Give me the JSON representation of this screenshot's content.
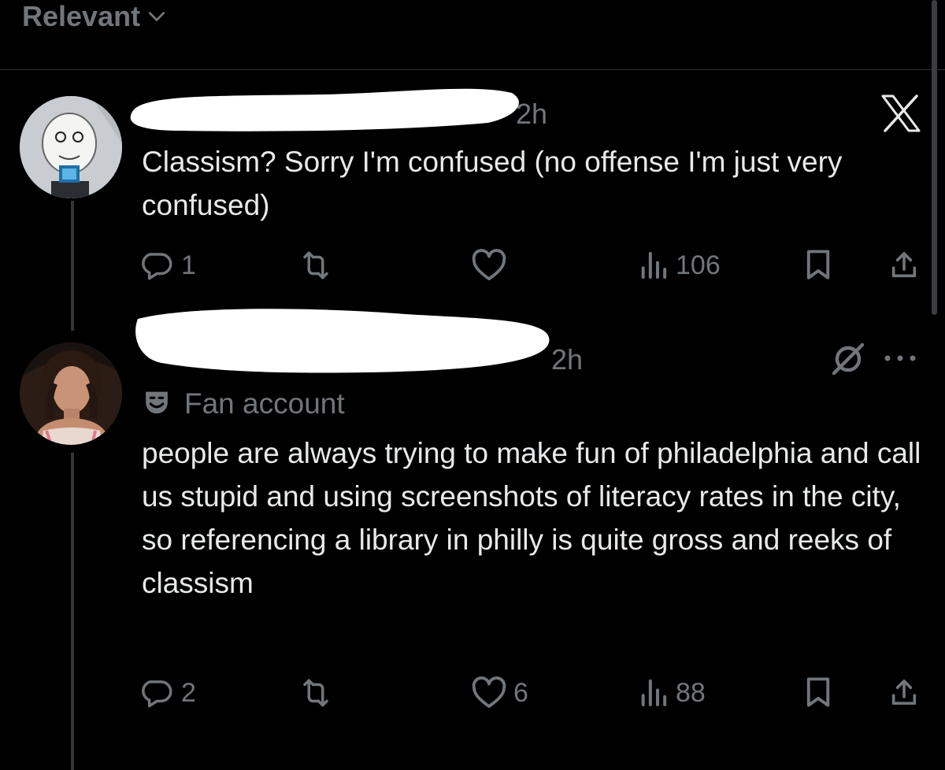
{
  "header": {
    "sort_label": "Relevant"
  },
  "replies": [
    {
      "time": "2h",
      "text": "Classism? Sorry I'm confused (no offense I'm just very confused)",
      "stats": {
        "replies": "1",
        "reposts": "",
        "likes": "",
        "views": "106"
      }
    },
    {
      "time": "2h",
      "badge": "Fan account",
      "text": "people are always trying to make fun of philadelphia and call us stupid and using screenshots of literacy rates in the city, so referencing a library in philly is quite gross and reeks of classism",
      "stats": {
        "replies": "2",
        "reposts": "",
        "likes": "6",
        "views": "88"
      }
    }
  ],
  "colors": {
    "background": "#000000",
    "text": "#e7e9ea",
    "muted": "#71767b",
    "divider": "#2f3336",
    "thread_line": "#333639"
  },
  "icons": [
    "chevron-down-icon",
    "x-logo-icon",
    "grok-icon",
    "more-icon",
    "theater-masks-icon",
    "reply-icon",
    "repost-icon",
    "like-icon",
    "views-icon",
    "bookmark-icon",
    "share-icon"
  ]
}
